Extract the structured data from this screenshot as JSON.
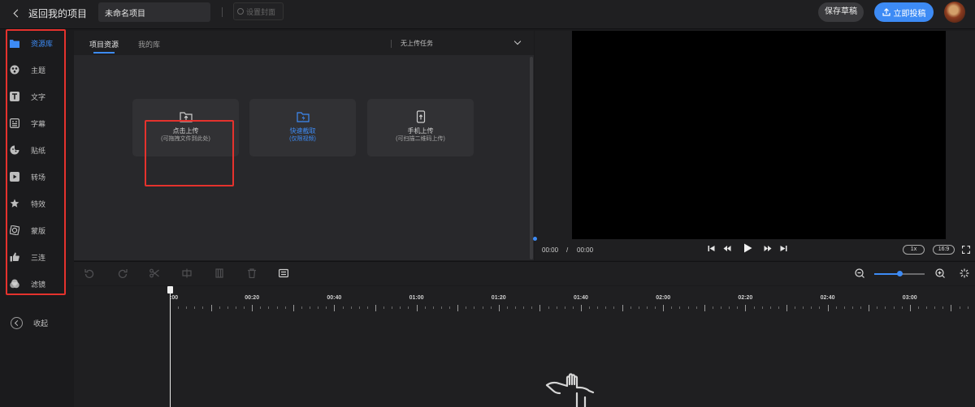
{
  "topbar": {
    "back_label": "返回我的项目",
    "project_name": "未命名项目",
    "cover_label": "设置封面",
    "save_draft_label": "保存草稿",
    "publish_label": "立即投稿"
  },
  "sidebar": {
    "items": [
      {
        "label": "资源库",
        "icon": "folder-icon",
        "active": true
      },
      {
        "label": "主题",
        "icon": "theme-icon",
        "active": false
      },
      {
        "label": "文字",
        "icon": "text-icon",
        "active": false
      },
      {
        "label": "字幕",
        "icon": "subtitle-icon",
        "active": false
      },
      {
        "label": "贴纸",
        "icon": "sticker-icon",
        "active": false
      },
      {
        "label": "转场",
        "icon": "transition-icon",
        "active": false
      },
      {
        "label": "特效",
        "icon": "effects-icon",
        "active": false
      },
      {
        "label": "蒙版",
        "icon": "mask-icon",
        "active": false
      },
      {
        "label": "三连",
        "icon": "thumbs-up-icon",
        "active": false
      },
      {
        "label": "滤镜",
        "icon": "filter-icon",
        "active": false
      }
    ],
    "collapse_label": "收起"
  },
  "resource_panel": {
    "tabs": [
      {
        "label": "项目资源",
        "active": true
      },
      {
        "label": "我的库",
        "active": false
      }
    ],
    "task_status": "无上传任务",
    "cards": [
      {
        "title": "点击上传",
        "subtitle": "(可拖拽文件到此处)",
        "icon": "upload-folder-icon"
      },
      {
        "title": "快速截取",
        "subtitle": "(仅限视频)",
        "icon": "lightning-folder-icon"
      },
      {
        "title": "手机上传",
        "subtitle": "(可扫描二维码上传)",
        "icon": "phone-upload-icon"
      }
    ]
  },
  "preview": {
    "current_time": "00:00",
    "separator": "/",
    "total_time": "00:00",
    "speed": "1x",
    "aspect_ratio": "16:9"
  },
  "timeline": {
    "ruler_labels": [
      ":00",
      "00:20",
      "00:40",
      "01:00",
      "01:20",
      "01:40",
      "02:00",
      "02:20",
      "02:40",
      "03:00"
    ]
  },
  "colors": {
    "accent": "#3d8bf5",
    "highlight_box": "#e5322d",
    "background": "#1b1b1d"
  }
}
